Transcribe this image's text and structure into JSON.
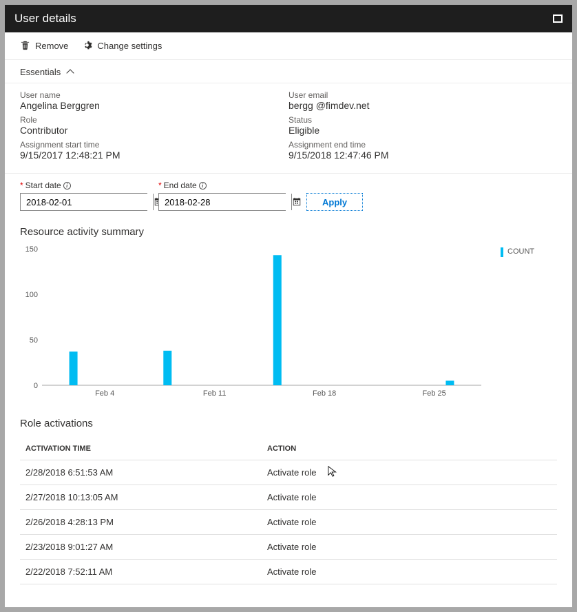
{
  "titlebar": {
    "title": "User details"
  },
  "toolbar": {
    "remove": "Remove",
    "change_settings": "Change settings"
  },
  "essentials": {
    "header": "Essentials",
    "left": {
      "user_name_label": "User name",
      "user_name": "Angelina Berggren",
      "role_label": "Role",
      "role": "Contributor",
      "assign_start_label": "Assignment start time",
      "assign_start": "9/15/2017 12:48:21 PM"
    },
    "right": {
      "user_email_label": "User email",
      "user_email": "bergg @fimdev.net",
      "status_label": "Status",
      "status": "Eligible",
      "assign_end_label": "Assignment end time",
      "assign_end": "9/15/2018 12:47:46 PM"
    }
  },
  "filters": {
    "start_label": "Start date",
    "start_value": "2018-02-01",
    "end_label": "End date",
    "end_value": "2018-02-28",
    "apply": "Apply"
  },
  "chart": {
    "title": "Resource activity summary",
    "legend": "COUNT"
  },
  "chart_data": {
    "type": "bar",
    "title": "Resource activity summary",
    "xlabel": "",
    "ylabel": "",
    "ylim": [
      0,
      150
    ],
    "x_ticks": [
      "Feb 4",
      "Feb 11",
      "Feb 18",
      "Feb 25"
    ],
    "y_ticks": [
      0,
      50,
      100,
      150
    ],
    "categories": [
      "Feb 2",
      "Feb 8",
      "Feb 15",
      "Feb 26"
    ],
    "values": [
      37,
      38,
      143,
      5
    ],
    "series_name": "COUNT",
    "color": "#00bcf2"
  },
  "activations": {
    "title": "Role activations",
    "columns": [
      "ACTIVATION TIME",
      "ACTION"
    ],
    "rows": [
      {
        "time": "2/28/2018 6:51:53 AM",
        "action": "Activate role"
      },
      {
        "time": "2/27/2018 10:13:05 AM",
        "action": "Activate role"
      },
      {
        "time": "2/26/2018 4:28:13 PM",
        "action": "Activate role"
      },
      {
        "time": "2/23/2018 9:01:27 AM",
        "action": "Activate role"
      },
      {
        "time": "2/22/2018 7:52:11 AM",
        "action": "Activate role"
      }
    ]
  }
}
